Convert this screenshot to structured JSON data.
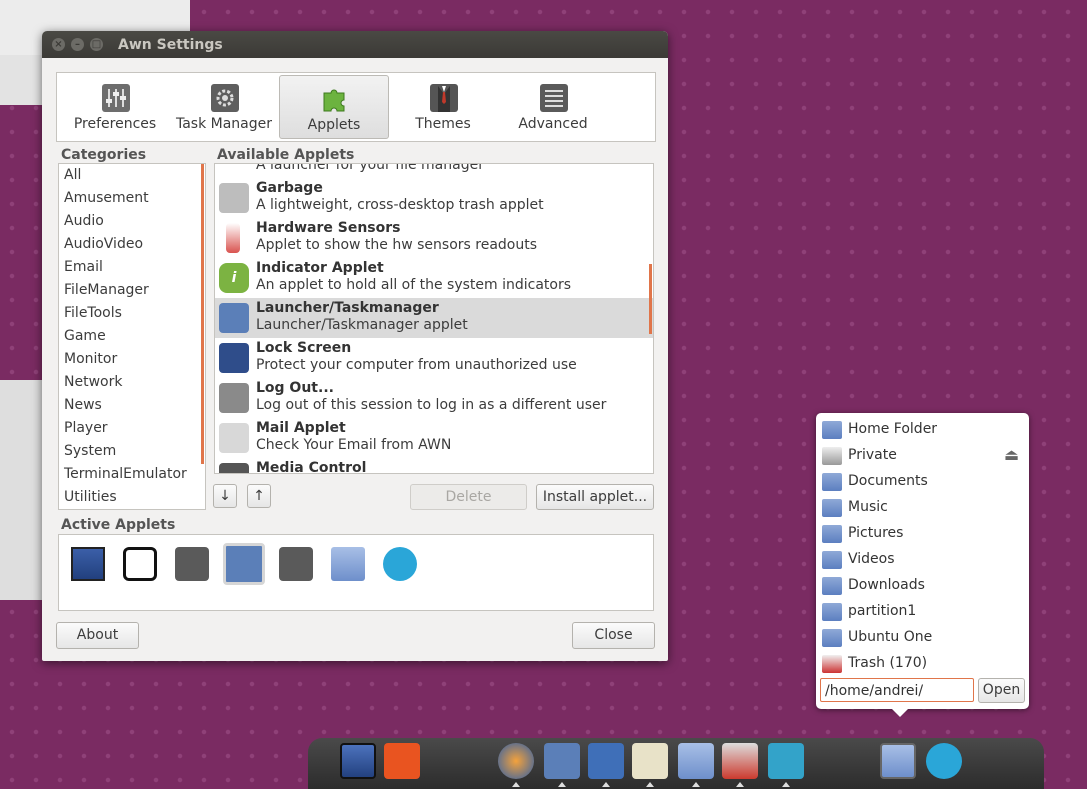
{
  "window": {
    "title": "Awn Settings",
    "close_glyph": "×",
    "min_glyph": "–",
    "max_glyph": "□"
  },
  "toolbar": {
    "items": [
      {
        "label": "Preferences",
        "icon": "preferences-icon"
      },
      {
        "label": "Task Manager",
        "icon": "gear-icon"
      },
      {
        "label": "Applets",
        "icon": "puzzle-icon"
      },
      {
        "label": "Themes",
        "icon": "suit-icon"
      },
      {
        "label": "Advanced",
        "icon": "list-icon"
      }
    ],
    "active": "Applets"
  },
  "categories": {
    "heading": "Categories",
    "items": [
      "All",
      "Amusement",
      "Audio",
      "AudioVideo",
      "Email",
      "FileManager",
      "FileTools",
      "Game",
      "Monitor",
      "Network",
      "News",
      "Player",
      "System",
      "TerminalEmulator",
      "Utilities"
    ]
  },
  "available": {
    "heading": "Available Applets",
    "partial_top": "A launcher for your file manager",
    "items": [
      {
        "name": "Garbage",
        "desc": "A lightweight, cross-desktop trash applet",
        "color": "#bdbdbd"
      },
      {
        "name": "Hardware Sensors",
        "desc": "Applet to show the hw sensors readouts",
        "color": "#d9534f"
      },
      {
        "name": "Indicator Applet",
        "desc": "An applet to hold all of the system indicators",
        "color": "#7cb342"
      },
      {
        "name": "Launcher/Taskmanager",
        "desc": "Launcher/Taskmanager applet",
        "color": "#5b7fb8"
      },
      {
        "name": "Lock Screen",
        "desc": "Protect your computer from unauthorized use",
        "color": "#2f4d8a"
      },
      {
        "name": "Log Out...",
        "desc": "Log out of this session to log in as a different user",
        "color": "#8a8a8a"
      },
      {
        "name": "Mail Applet",
        "desc": "Check Your Email from AWN",
        "color": "#d8d8d8"
      },
      {
        "name": "Media Control",
        "desc": "",
        "color": "#555555"
      }
    ],
    "selected": "Launcher/Taskmanager"
  },
  "buttons": {
    "move_down": "↓",
    "move_up": "↑",
    "delete": "Delete",
    "install": "Install applet...",
    "about": "About",
    "close": "Close"
  },
  "active_applets": {
    "heading": "Active Applets",
    "items": [
      "desktop-icon",
      "list-icon",
      "separator-icon",
      "launcher-icon",
      "separator-icon",
      "folder-icon",
      "chat-icon"
    ]
  },
  "places": {
    "items": [
      {
        "label": "Home Folder",
        "icon": "home-folder-icon"
      },
      {
        "label": "Private",
        "icon": "drive-icon"
      },
      {
        "label": "Documents",
        "icon": "folder-icon"
      },
      {
        "label": "Music",
        "icon": "music-folder-icon"
      },
      {
        "label": "Pictures",
        "icon": "pictures-folder-icon"
      },
      {
        "label": "Videos",
        "icon": "videos-folder-icon"
      },
      {
        "label": "Downloads",
        "icon": "downloads-folder-icon"
      },
      {
        "label": "partition1",
        "icon": "folder-icon"
      },
      {
        "label": "Ubuntu One",
        "icon": "folder-icon"
      },
      {
        "label": "Trash (170)",
        "icon": "trash-icon"
      }
    ],
    "eject_glyph": "⏏",
    "path_value": "/home/andrei/",
    "open_label": "Open"
  },
  "dock": {
    "items": [
      {
        "name": "desktop-icon",
        "color": "#3b5fa8"
      },
      {
        "name": "ubuntu-icon",
        "color": "#e95420"
      },
      {
        "name": "firefox-icon",
        "color": "#e66a1f"
      },
      {
        "name": "launcher-icon",
        "color": "#5b7fb8"
      },
      {
        "name": "ypa-icon",
        "color": "#3f6fb8"
      },
      {
        "name": "notepad-icon",
        "color": "#e8e2c8"
      },
      {
        "name": "folder-icon",
        "color": "#8aa6d6"
      },
      {
        "name": "toolbox-icon",
        "color": "#cc3a2e"
      },
      {
        "name": "monitor-icon",
        "color": "#33a3c9"
      },
      {
        "name": "folder-icon",
        "color": "#8aa6d6"
      },
      {
        "name": "chat-icon",
        "color": "#2aa6d8"
      }
    ]
  },
  "colors": {
    "accent": "#e0754a",
    "background": "#7a2b62"
  }
}
